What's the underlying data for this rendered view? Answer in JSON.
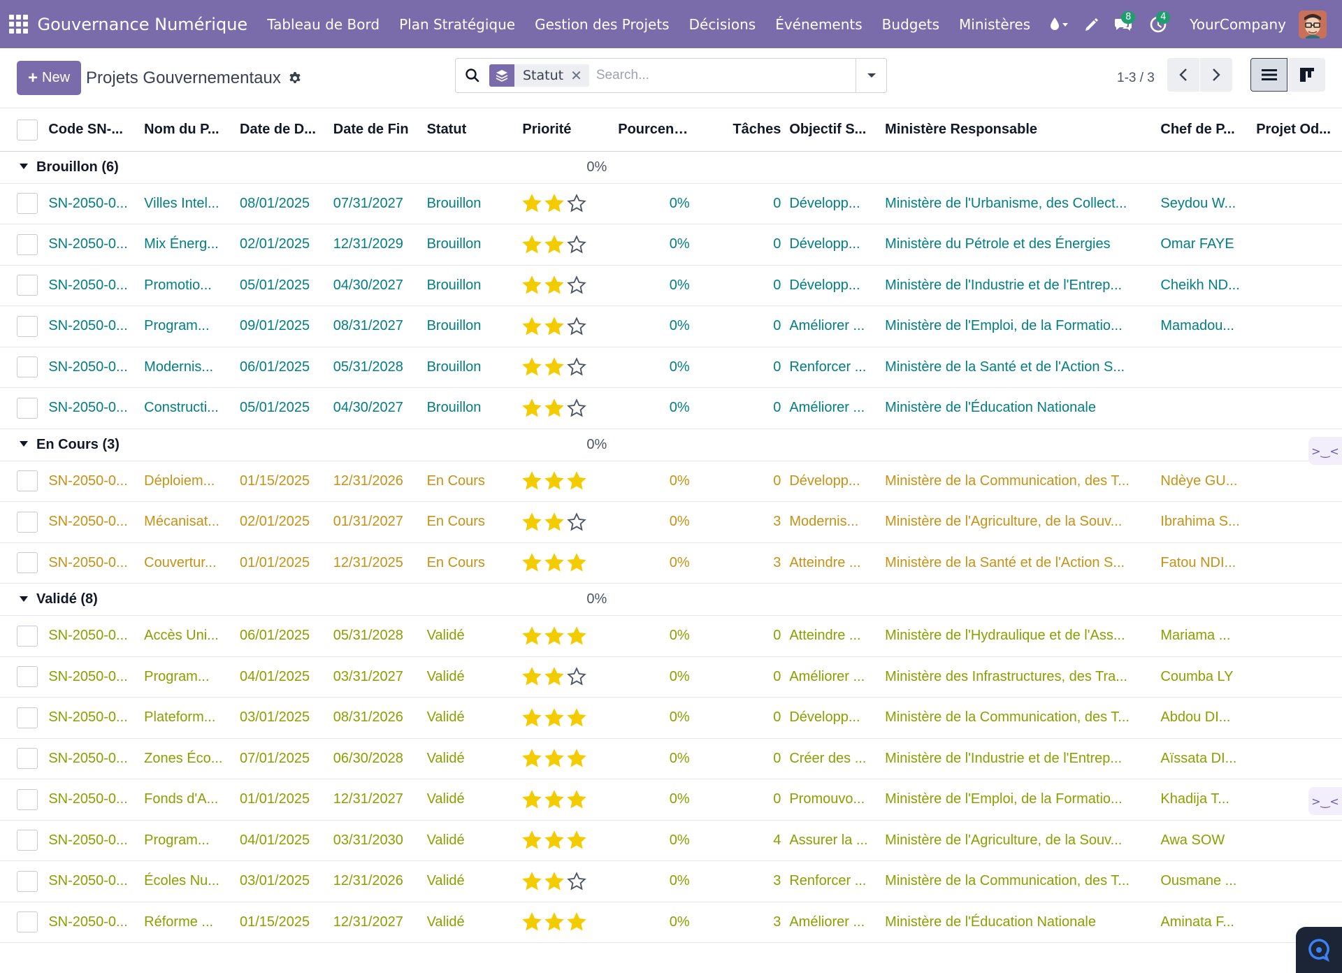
{
  "nav": {
    "brand": "Gouvernance Numérique",
    "menu": [
      "Tableau de Bord",
      "Plan Stratégique",
      "Gestion des Projets",
      "Décisions",
      "Événements",
      "Budgets",
      "Ministères"
    ],
    "messages_count": "8",
    "activities_count": "4",
    "company": "YourCompany",
    "accent_color": "#7a6baa"
  },
  "control_panel": {
    "new_label": "New",
    "title": "Projets Gouvernementaux",
    "search_facet": "Statut",
    "search_placeholder": "Search...",
    "pager": "1-3 / 3"
  },
  "table": {
    "columns": [
      "Code SN-...",
      "Nom du P...",
      "Date de D...",
      "Date de Fin",
      "Statut",
      "Priorité",
      "Pourcenta...",
      "Tâches",
      "Objectif S...",
      "Ministère Responsable",
      "Chef de P...",
      "Projet Od..."
    ],
    "groups": [
      {
        "label": "Brouillon (6)",
        "percent": "0%",
        "color": "#017e84",
        "rows": [
          {
            "code": "SN-2050-0...",
            "name": "Villes Intel...",
            "start": "08/01/2025",
            "end": "07/31/2027",
            "status": "Brouillon",
            "priority": 2,
            "percent": "0%",
            "tasks": "0",
            "objective": "Développ...",
            "ministry": "Ministère de l'Urbanisme, des Collect...",
            "manager": "Seydou W..."
          },
          {
            "code": "SN-2050-0...",
            "name": "Mix Énerg...",
            "start": "02/01/2025",
            "end": "12/31/2029",
            "status": "Brouillon",
            "priority": 2,
            "percent": "0%",
            "tasks": "0",
            "objective": "Développ...",
            "ministry": "Ministère du Pétrole et des Énergies",
            "manager": "Omar FAYE"
          },
          {
            "code": "SN-2050-0...",
            "name": "Promotio...",
            "start": "05/01/2025",
            "end": "04/30/2027",
            "status": "Brouillon",
            "priority": 2,
            "percent": "0%",
            "tasks": "0",
            "objective": "Développ...",
            "ministry": "Ministère de l'Industrie et de l'Entrep...",
            "manager": "Cheikh ND..."
          },
          {
            "code": "SN-2050-0...",
            "name": "Program...",
            "start": "09/01/2025",
            "end": "08/31/2027",
            "status": "Brouillon",
            "priority": 2,
            "percent": "0%",
            "tasks": "0",
            "objective": "Améliorer ...",
            "ministry": "Ministère de l'Emploi, de la Formatio...",
            "manager": "Mamadou..."
          },
          {
            "code": "SN-2050-0...",
            "name": "Modernis...",
            "start": "06/01/2025",
            "end": "05/31/2028",
            "status": "Brouillon",
            "priority": 2,
            "percent": "0%",
            "tasks": "0",
            "objective": "Renforcer ...",
            "ministry": "Ministère de la Santé et de l'Action S...",
            "manager": ""
          },
          {
            "code": "SN-2050-0...",
            "name": "Constructi...",
            "start": "05/01/2025",
            "end": "04/30/2027",
            "status": "Brouillon",
            "priority": 2,
            "percent": "0%",
            "tasks": "0",
            "objective": "Améliorer ...",
            "ministry": "Ministère de l'Éducation Nationale",
            "manager": ""
          }
        ]
      },
      {
        "label": "En Cours (3)",
        "percent": "0%",
        "color": "#c59216",
        "rows": [
          {
            "code": "SN-2050-0...",
            "name": "Déploiem...",
            "start": "01/15/2025",
            "end": "12/31/2026",
            "status": "En Cours",
            "priority": 3,
            "percent": "0%",
            "tasks": "0",
            "objective": "Développ...",
            "ministry": "Ministère de la Communication, des T...",
            "manager": "Ndèye GU..."
          },
          {
            "code": "SN-2050-0...",
            "name": "Mécanisat...",
            "start": "02/01/2025",
            "end": "01/31/2027",
            "status": "En Cours",
            "priority": 2,
            "percent": "0%",
            "tasks": "3",
            "objective": "Modernis...",
            "ministry": "Ministère de l'Agriculture, de la Souv...",
            "manager": "Ibrahima S..."
          },
          {
            "code": "SN-2050-0...",
            "name": "Couvertur...",
            "start": "01/01/2025",
            "end": "12/31/2025",
            "status": "En Cours",
            "priority": 3,
            "percent": "0%",
            "tasks": "3",
            "objective": "Atteindre ...",
            "ministry": "Ministère de la Santé et de l'Action S...",
            "manager": "Fatou NDI..."
          }
        ]
      },
      {
        "label": "Validé (8)",
        "percent": "0%",
        "color": "#86a200",
        "rows": [
          {
            "code": "SN-2050-0...",
            "name": "Accès Uni...",
            "start": "06/01/2025",
            "end": "05/31/2028",
            "status": "Validé",
            "priority": 3,
            "percent": "0%",
            "tasks": "0",
            "objective": "Atteindre ...",
            "ministry": "Ministère de l'Hydraulique et de l'Ass...",
            "manager": "Mariama ..."
          },
          {
            "code": "SN-2050-0...",
            "name": "Program...",
            "start": "04/01/2025",
            "end": "03/31/2027",
            "status": "Validé",
            "priority": 2,
            "percent": "0%",
            "tasks": "0",
            "objective": "Améliorer ...",
            "ministry": "Ministère des Infrastructures, des Tra...",
            "manager": "Coumba LY"
          },
          {
            "code": "SN-2050-0...",
            "name": "Plateform...",
            "start": "03/01/2025",
            "end": "08/31/2026",
            "status": "Validé",
            "priority": 3,
            "percent": "0%",
            "tasks": "0",
            "objective": "Développ...",
            "ministry": "Ministère de la Communication, des T...",
            "manager": "Abdou DI..."
          },
          {
            "code": "SN-2050-0...",
            "name": "Zones Éco...",
            "start": "07/01/2025",
            "end": "06/30/2028",
            "status": "Validé",
            "priority": 3,
            "percent": "0%",
            "tasks": "0",
            "objective": "Créer des ...",
            "ministry": "Ministère de l'Industrie et de l'Entrep...",
            "manager": "Aïssata DI..."
          },
          {
            "code": "SN-2050-0...",
            "name": "Fonds d'A...",
            "start": "01/01/2025",
            "end": "12/31/2027",
            "status": "Validé",
            "priority": 3,
            "percent": "0%",
            "tasks": "0",
            "objective": "Promouvo...",
            "ministry": "Ministère de l'Emploi, de la Formatio...",
            "manager": "Khadija T..."
          },
          {
            "code": "SN-2050-0...",
            "name": "Program...",
            "start": "04/01/2025",
            "end": "03/31/2030",
            "status": "Validé",
            "priority": 3,
            "percent": "0%",
            "tasks": "4",
            "objective": "Assurer la ...",
            "ministry": "Ministère de l'Agriculture, de la Souv...",
            "manager": "Awa SOW"
          },
          {
            "code": "SN-2050-0...",
            "name": "Écoles Nu...",
            "start": "03/01/2025",
            "end": "12/31/2026",
            "status": "Validé",
            "priority": 2,
            "percent": "0%",
            "tasks": "3",
            "objective": "Renforcer ...",
            "ministry": "Ministère de la Communication, des T...",
            "manager": "Ousmane ..."
          },
          {
            "code": "SN-2050-0...",
            "name": "Réforme ...",
            "start": "01/15/2025",
            "end": "12/31/2027",
            "status": "Validé",
            "priority": 3,
            "percent": "0%",
            "tasks": "3",
            "objective": "Améliorer ...",
            "ministry": "Ministère de l'Éducation Nationale",
            "manager": "Aminata F..."
          }
        ]
      }
    ]
  }
}
